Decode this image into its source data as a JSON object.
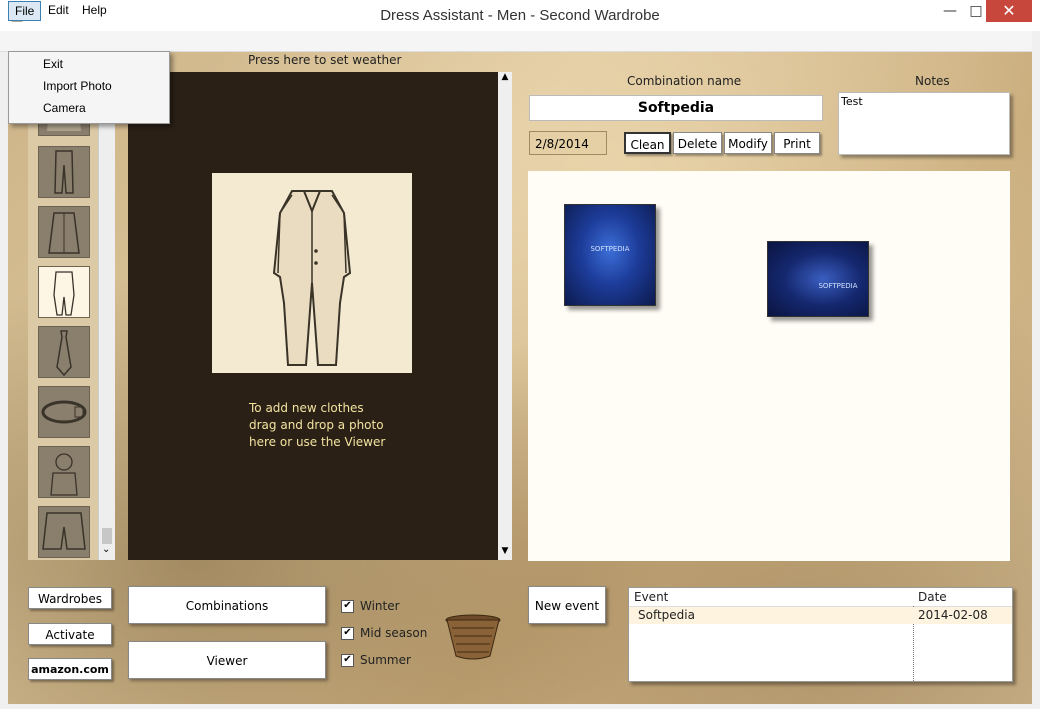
{
  "window": {
    "title": "Dress Assistant - Men - Second Wardrobe",
    "minimize": "—",
    "maximize": "□",
    "close": "✕"
  },
  "menubar": {
    "items": [
      {
        "label": "File"
      },
      {
        "label": "Edit"
      },
      {
        "label": "Help"
      }
    ],
    "file_menu": [
      {
        "label": "Exit"
      },
      {
        "label": "Import Photo"
      },
      {
        "label": "Camera"
      }
    ]
  },
  "weather_label": "Press here to set weather",
  "viewer_hint": [
    "To add new clothes",
    "drag and drop a photo",
    "here or use the Viewer"
  ],
  "combination": {
    "name_label": "Combination name",
    "name_value": "Softpedia",
    "notes_label": "Notes",
    "notes_value": "Test",
    "date": "2/8/2014",
    "buttons": {
      "clean": "Clean",
      "delete": "Delete",
      "modify": "Modify",
      "print": "Print"
    },
    "photos": [
      {
        "caption": "SOFTPEDIA"
      },
      {
        "caption": "SOFTPEDIA"
      }
    ]
  },
  "left_buttons": {
    "wardrobes": "Wardrobes",
    "activate": "Activate",
    "amazon": "amazon.com"
  },
  "main_buttons": {
    "combinations": "Combinations",
    "viewer": "Viewer",
    "new_event": "New event"
  },
  "seasons": [
    {
      "label": "Winter",
      "checked": true
    },
    {
      "label": "Mid season",
      "checked": true
    },
    {
      "label": "Summer",
      "checked": true
    }
  ],
  "events": {
    "columns": [
      "Event",
      "Date"
    ],
    "rows": [
      {
        "event": "Softpedia",
        "date": "2014-02-08"
      }
    ]
  },
  "thumbnails": [
    "shirt-thumb",
    "pants-thumb",
    "coat-thumb",
    "suit-thumb",
    "tie-thumb",
    "belt-thumb",
    "scarf-thumb",
    "shorts-thumb"
  ],
  "colors": {
    "viewer_bg": "#2a2016",
    "hint_text": "#f3e3a0",
    "close_btn": "#c7473c"
  }
}
